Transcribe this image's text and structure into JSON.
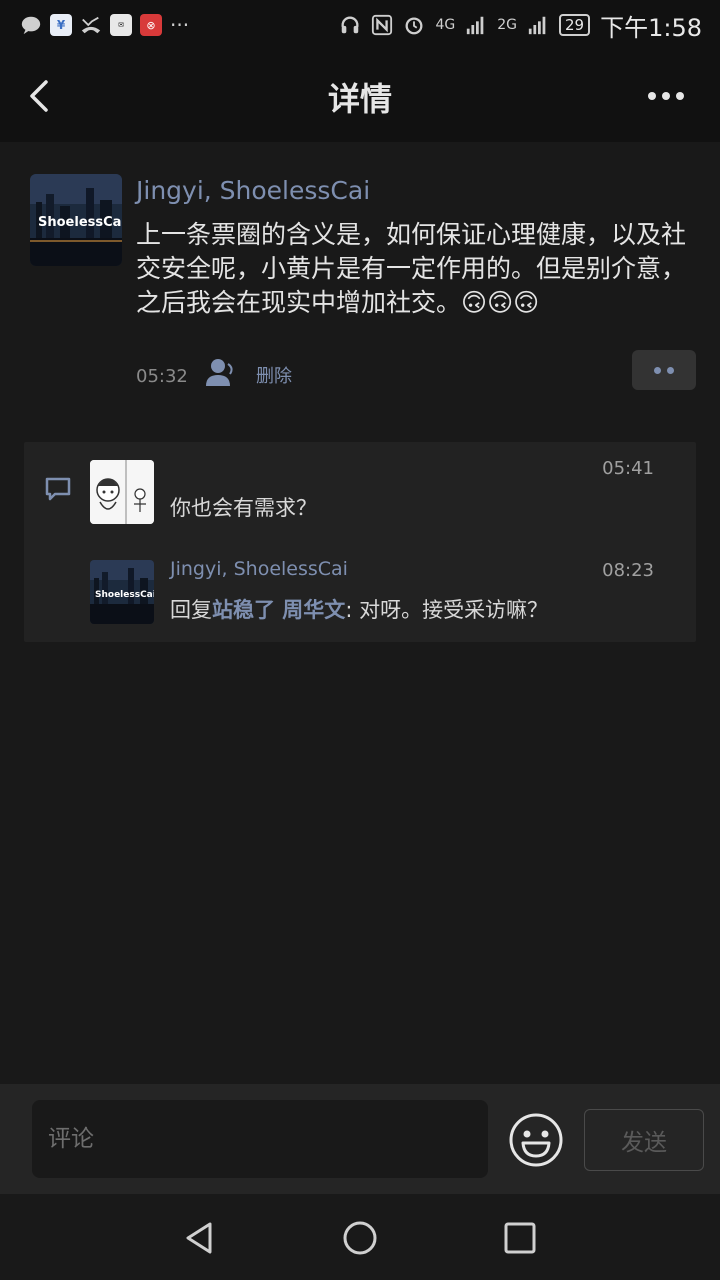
{
  "status_bar": {
    "time": "下午1:58",
    "battery": "29",
    "network_1": "4G",
    "network_2": "2G",
    "icons": [
      "message-icon",
      "phone-assistant-icon",
      "missed-call-icon",
      "huawei-mail-icon",
      "app-badge-icon",
      "more-notifications-icon",
      "headset-icon",
      "nfc-icon",
      "alarm-icon",
      "signal-icon",
      "battery-icon"
    ]
  },
  "nav": {
    "title": "详情"
  },
  "post": {
    "avatar_text": "ShoelessCai",
    "author": "Jingyi, ShoelessCai",
    "text": "上一条票圈的含义是，如何保证心理健康，以及社交安全呢，小黄片是有一定作用的。但是别介意，之后我会在现实中增加社交。🙃🙃🙃",
    "time": "05:32",
    "delete_label": "删除"
  },
  "comments": [
    {
      "text": "你也会有需求？",
      "time": "05:41"
    },
    {
      "author": "Jingyi, ShoelessCai",
      "avatar_text": "ShoelessCai",
      "reply_prefix": "回复",
      "reply_to": "站稳了 周华文",
      "text": ": 对呀。接受采访嘛？",
      "time": "08:23"
    }
  ],
  "input_bar": {
    "placeholder": "评论",
    "send_label": "发送"
  },
  "colors": {
    "background": "#191919",
    "link": "#7e8fb0",
    "header": "#111111"
  }
}
